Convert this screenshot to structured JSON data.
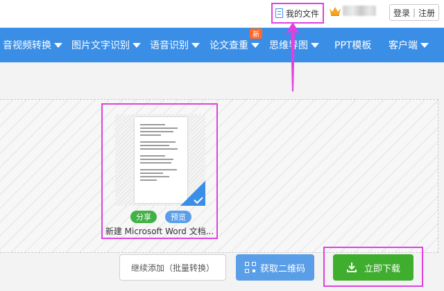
{
  "topbar": {
    "my_files_label": "我的文件",
    "login_label": "登录",
    "separator": "|",
    "register_label": "注册"
  },
  "nav": {
    "items": [
      {
        "label": "音视频转换",
        "has_dropdown": true
      },
      {
        "label": "图片文字识别",
        "has_dropdown": true
      },
      {
        "label": "语音识别",
        "has_dropdown": true
      },
      {
        "label": "论文查重",
        "has_dropdown": true,
        "badge": "新"
      },
      {
        "label": "思维导图",
        "has_dropdown": true
      },
      {
        "label": "PPT模板",
        "has_dropdown": false
      },
      {
        "label": "客户端",
        "has_dropdown": true
      }
    ]
  },
  "file_card": {
    "share_label": "分享",
    "preview_label": "预览",
    "file_name": "新建 Microsoft Word 文档..."
  },
  "actions": {
    "continue_label": "继续添加（批量转换）",
    "qr_label": "获取二维码",
    "download_label": "立即下载"
  },
  "colors": {
    "nav_blue": "#3a8ee6",
    "highlight": "#e040e0",
    "download_green": "#3fad2e",
    "share_green": "#43b244",
    "badge_orange": "#ff6a2b"
  },
  "icons": [
    "document-icon",
    "crown-icon",
    "caret-down-icon",
    "checkmark-icon",
    "qr-code-icon",
    "download-icon"
  ]
}
